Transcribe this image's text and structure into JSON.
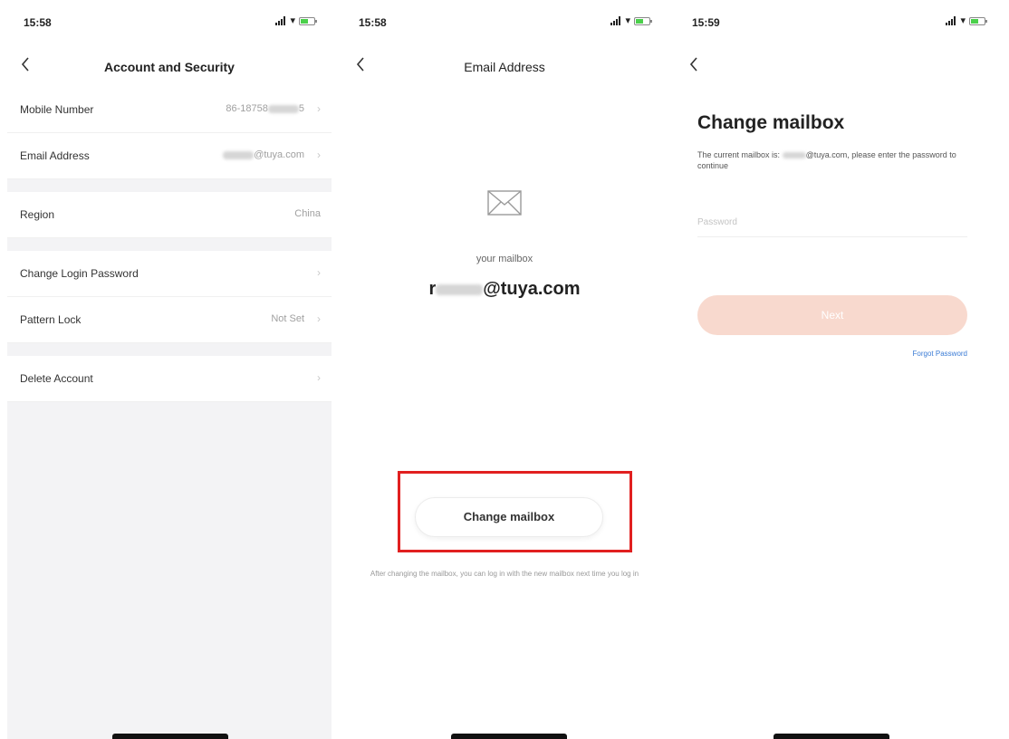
{
  "screens": [
    {
      "time": "15:58",
      "title": "Account and Security",
      "rows": [
        {
          "label": "Mobile Number",
          "value": "86-18758",
          "value_tail": "5"
        },
        {
          "label": "Email Address",
          "value_head": "",
          "value": "@tuya.com"
        },
        {
          "label": "Region",
          "value": "China"
        },
        {
          "label": "Change Login Password",
          "value": ""
        },
        {
          "label": "Pattern Lock",
          "value": "Not Set"
        },
        {
          "label": "Delete Account",
          "value": ""
        }
      ]
    },
    {
      "time": "15:58",
      "title": "Email Address",
      "caption": "your mailbox",
      "address_head": "r",
      "address_tail": "@tuya.com",
      "button": "Change mailbox",
      "hint": "After changing the mailbox, you can log in with the new mailbox next time you log in"
    },
    {
      "time": "15:59",
      "heading": "Change mailbox",
      "desc_before": "The current mailbox is:",
      "desc_after": "@tuya.com, please enter the password to continue",
      "password_placeholder": "Password",
      "next_label": "Next",
      "forgot_label": "Forgot Password"
    }
  ],
  "colors": {
    "highlight": "#e12020",
    "next_button": "#f8d9ce",
    "link": "#3a7bd5",
    "section_bg": "#f3f3f5"
  },
  "icons": {
    "back": "chevron-left-icon",
    "chevron": "chevron-right-icon",
    "mail": "envelope-icon",
    "signal": "signal-icon",
    "wifi": "wifi-icon",
    "battery": "battery-icon"
  }
}
